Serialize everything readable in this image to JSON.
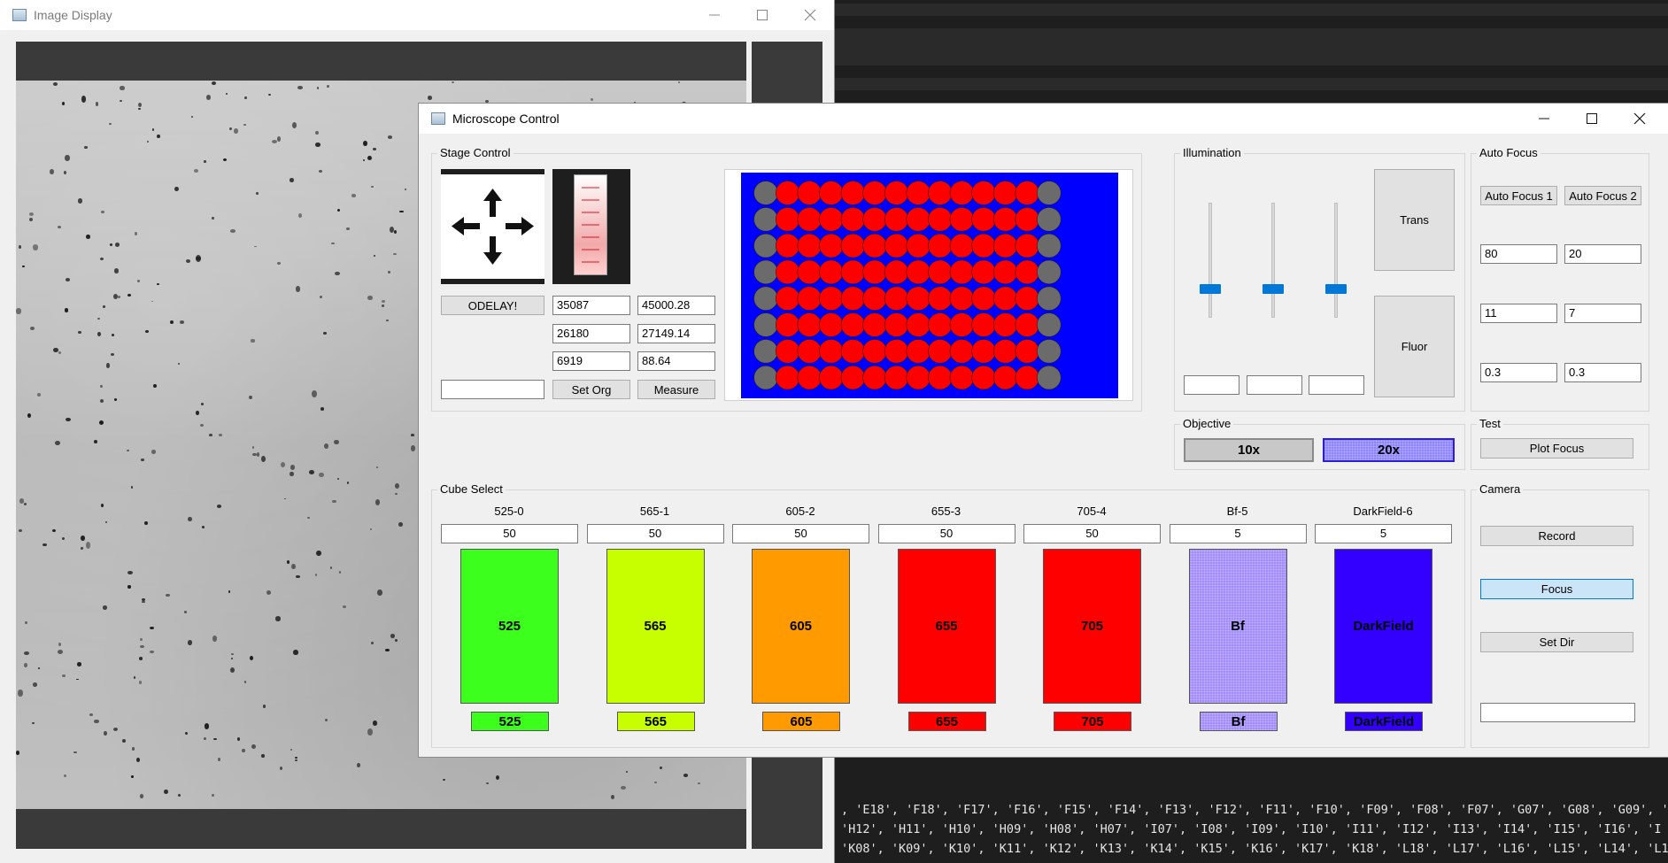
{
  "image_window": {
    "title": "Image Display"
  },
  "terminal": {
    "lines": [
      ", 'E18', 'F18', 'F17', 'F16', 'F15', 'F14', 'F13', 'F12', 'F11', 'F10', 'F09', 'F08', 'F07', 'G07', 'G08', 'G09', '",
      " 'H12', 'H11', 'H10', 'H09', 'H08', 'H07', 'I07', 'I08', 'I09', 'I10', 'I11', 'I12', 'I13', 'I14', 'I15', 'I16', 'I",
      "'K08', 'K09', 'K10', 'K11', 'K12', 'K13', 'K14', 'K15', 'K16', 'K17', 'K18', 'L18', 'L17', 'L16', 'L15', 'L14', 'L1"
    ]
  },
  "control_window": {
    "title": "Microscope Control"
  },
  "stage": {
    "group_title": "Stage Control",
    "odelay_label": "ODELAY!",
    "x_pos": "35087",
    "x_target": "45000.28",
    "y_pos": "26180",
    "y_target": "27149.14",
    "z_pos": "6919",
    "z_target": "88.64",
    "entry_value": "",
    "set_org_label": "Set Org",
    "measure_label": "Measure"
  },
  "plate": {
    "rows": 8,
    "cols": 14,
    "colors": {
      "background": "#0000ff",
      "well": "#ff0000",
      "edge_well": "#6b6b6b"
    }
  },
  "illumination": {
    "group_title": "Illumination",
    "sliders": [
      {
        "level": 0.2,
        "value": ""
      },
      {
        "level": 0.2,
        "value": ""
      },
      {
        "level": 0.2,
        "value": ""
      }
    ],
    "trans_label": "Trans",
    "fluor_label": "Fluor"
  },
  "autofocus": {
    "group_title": "Auto Focus",
    "af1_label": "Auto Focus 1",
    "af2_label": "Auto Focus 2",
    "values": [
      [
        "80",
        "20"
      ],
      [
        "11",
        "7"
      ],
      [
        "0.3",
        "0.3"
      ]
    ]
  },
  "objective": {
    "group_title": "Objective",
    "options": [
      {
        "label": "10x",
        "selected": false
      },
      {
        "label": "20x",
        "selected": true
      }
    ]
  },
  "test": {
    "group_title": "Test",
    "plot_focus_label": "Plot Focus"
  },
  "cube": {
    "group_title": "Cube Select",
    "cubes": [
      {
        "name": "525-0",
        "value": "50",
        "label": "525",
        "color": "#3cff1e"
      },
      {
        "name": "565-1",
        "value": "50",
        "label": "565",
        "color": "#c8ff00"
      },
      {
        "name": "605-2",
        "value": "50",
        "label": "605",
        "color": "#ff9a00"
      },
      {
        "name": "655-3",
        "value": "50",
        "label": "655",
        "color": "#ff0000"
      },
      {
        "name": "705-4",
        "value": "50",
        "label": "705",
        "color": "#ff0000"
      },
      {
        "name": "Bf-5",
        "value": "5",
        "label": "Bf",
        "color": "#a28cff"
      },
      {
        "name": "DarkField-6",
        "value": "5",
        "label": "DarkField",
        "color": "#3300ff"
      }
    ]
  },
  "camera": {
    "group_title": "Camera",
    "record_label": "Record",
    "focus_label": "Focus",
    "set_dir_label": "Set Dir",
    "dir_value": ""
  }
}
